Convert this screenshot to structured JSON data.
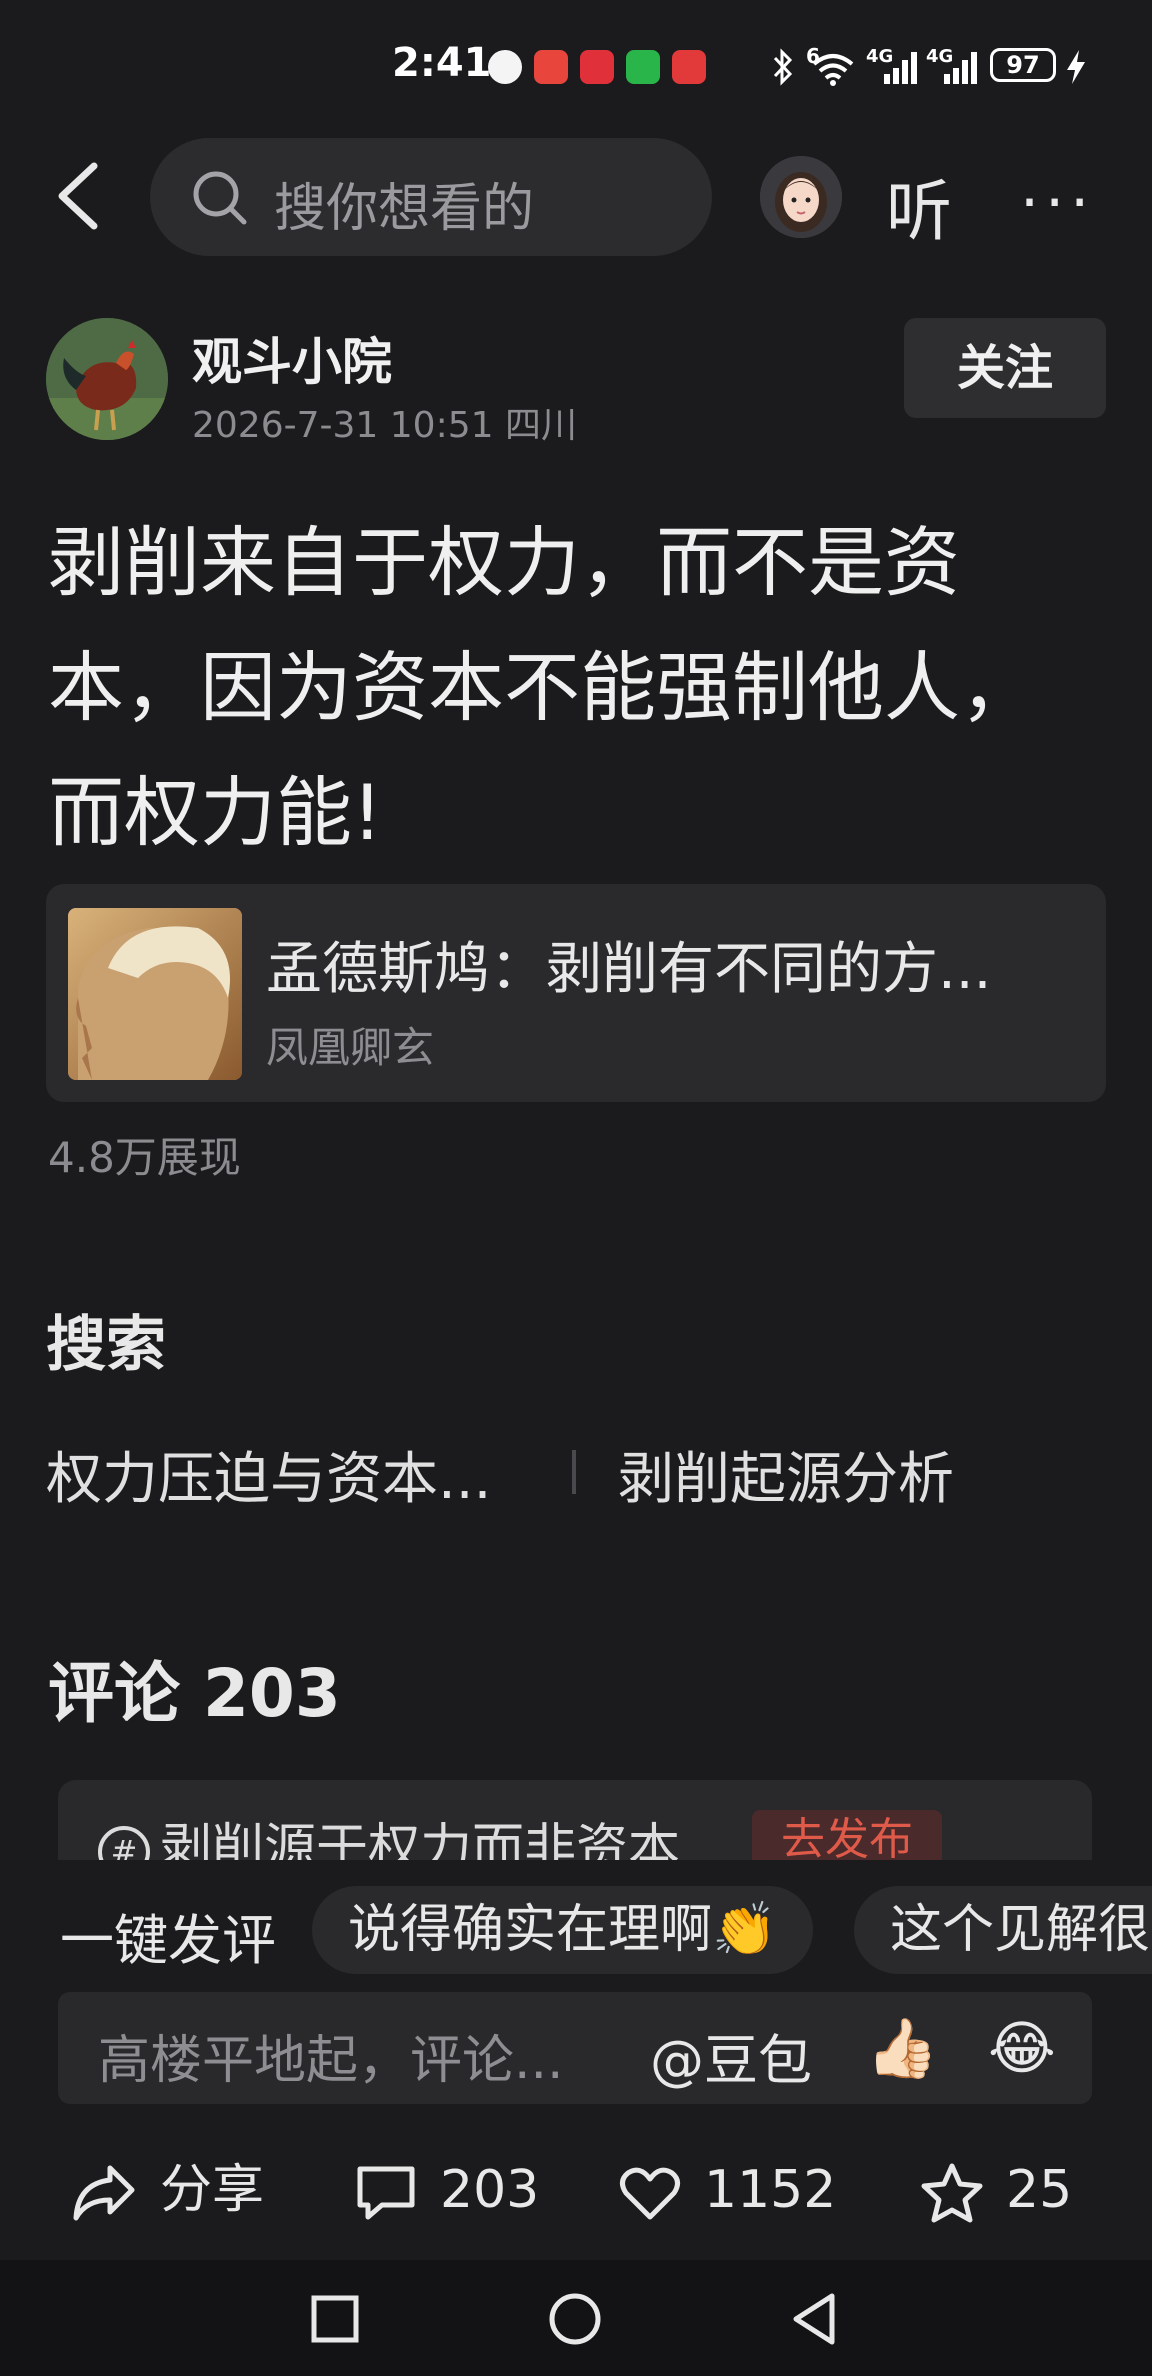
{
  "status_bar": {
    "time": "2:41",
    "network_labels": [
      "6",
      "4G",
      "4G"
    ],
    "battery": "97"
  },
  "header": {
    "search_placeholder": "搜你想看的",
    "listen_label": "听",
    "more_label": "···"
  },
  "post": {
    "author": "观斗小院",
    "meta": "2026-7-31 10:51 四川",
    "follow_label": "关注",
    "content": "剥削来自于权力，而不是资本，因为资本不能强制他人，而权力能!",
    "quoted": {
      "title": "孟德斯鸠：剥削有不同的方...",
      "source": "凤凰卿玄"
    },
    "views": "4.8万展现"
  },
  "search_section": {
    "heading": "搜索",
    "related": [
      "权力压迫与资本...",
      "剥削起源分析"
    ]
  },
  "comments": {
    "heading": "评论 203",
    "topic_text": "剥削源于权力而非资本",
    "topic_badge": "去发布"
  },
  "composer": {
    "quick_label": "一键发评",
    "chips": [
      "说得确实在理啊👏",
      "这个见解很"
    ],
    "placeholder": "高楼平地起，评论...",
    "mention": "@豆包",
    "emoji_1": "👍🏻",
    "emoji_2": "😂"
  },
  "actions": {
    "share_label": "分享",
    "comment_count": "203",
    "like_count": "1152",
    "favorite_count": "25"
  }
}
